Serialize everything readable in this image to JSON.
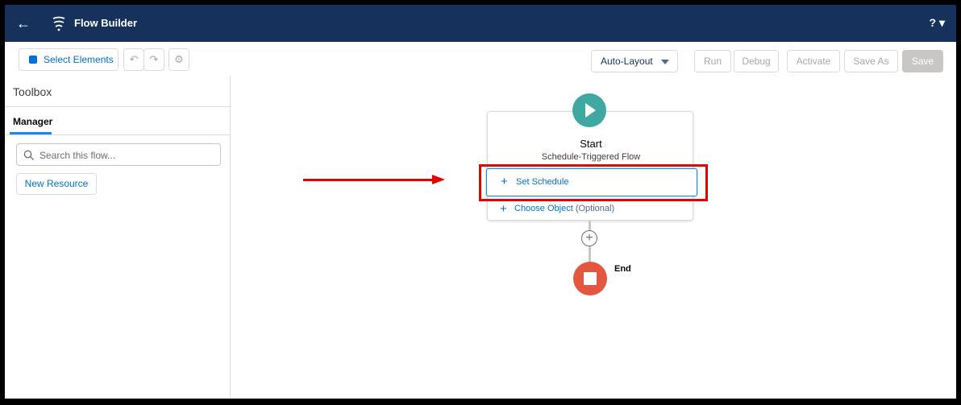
{
  "header": {
    "back_icon": "arrow-left-icon",
    "app_icon": "flow-icon",
    "title": "Flow Builder",
    "help_label": "? ▾"
  },
  "toolbar": {
    "select_elements_label": "Select Elements",
    "undo_icon": "undo-icon",
    "redo_icon": "redo-icon",
    "settings_icon": "gear-icon",
    "layout_select": {
      "value": "Auto-Layout"
    },
    "run_label": "Run",
    "debug_label": "Debug",
    "activate_label": "Activate",
    "save_as_label": "Save As",
    "save_label": "Save"
  },
  "sidebar": {
    "title": "Toolbox",
    "tabs": [
      {
        "label": "Manager",
        "active": true
      }
    ],
    "search": {
      "placeholder": "Search this flow..."
    },
    "new_resource_label": "New Resource"
  },
  "canvas": {
    "start": {
      "label": "Start",
      "subtitle": "Schedule-Triggered Flow",
      "set_schedule_label": "Set Schedule",
      "choose_object_label": "Choose Object",
      "choose_object_optional": "(Optional)"
    },
    "end": {
      "label": "End"
    }
  },
  "colors": {
    "header_bg": "#16325c",
    "brand_blue": "#0070d2",
    "start_teal": "#3fa8a0",
    "end_red": "#e3573f",
    "annotation_red": "#e60000"
  }
}
